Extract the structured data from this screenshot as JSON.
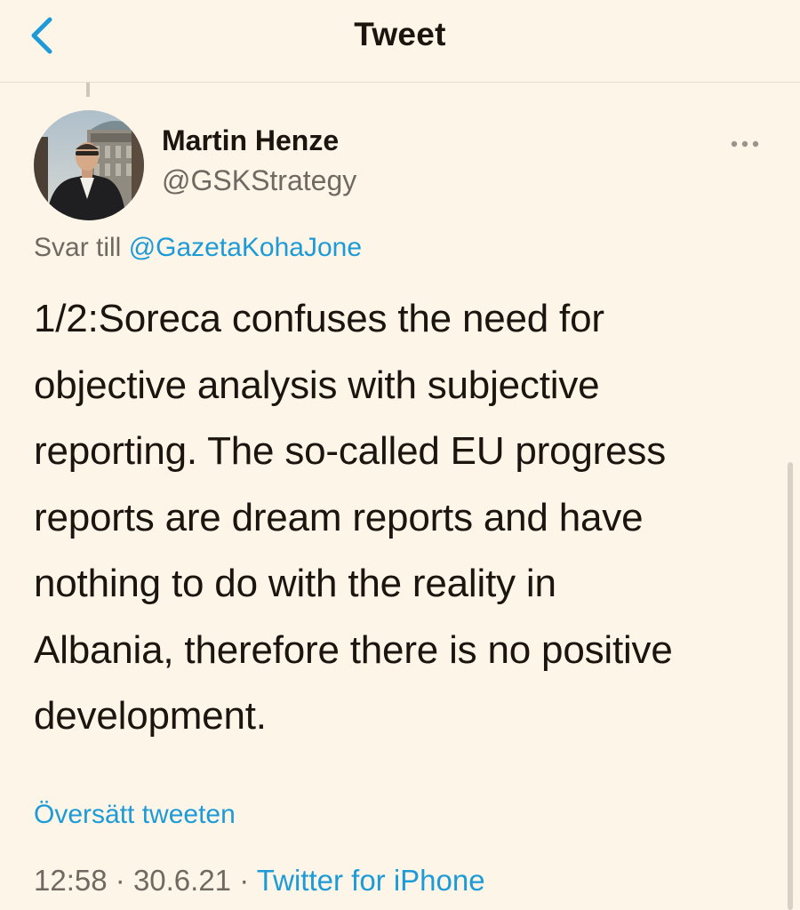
{
  "nav": {
    "title": "Tweet",
    "back_icon": "chevron-left-icon",
    "accent_color": "#1d9bd7"
  },
  "author": {
    "name": "Martin Henze",
    "handle": "@GSKStrategy"
  },
  "reply": {
    "prefix": "Svar till",
    "target": "@GazetaKohaJone"
  },
  "tweet": {
    "lines": [
      "1/2:Soreca confuses the need for",
      "objective analysis with subjective",
      "reporting. The so-called EU progress",
      "reports are dream reports and have",
      "nothing to do with the reality in",
      "Albania, therefore there is no positive",
      "development."
    ]
  },
  "translate_label": "Översätt tweeten",
  "meta": {
    "time": "12:58",
    "separator": "·",
    "date": "30.6.21",
    "source": "Twitter for iPhone"
  },
  "icons": {
    "more": "more-horizontal-icon",
    "avatar": "avatar-photo"
  }
}
